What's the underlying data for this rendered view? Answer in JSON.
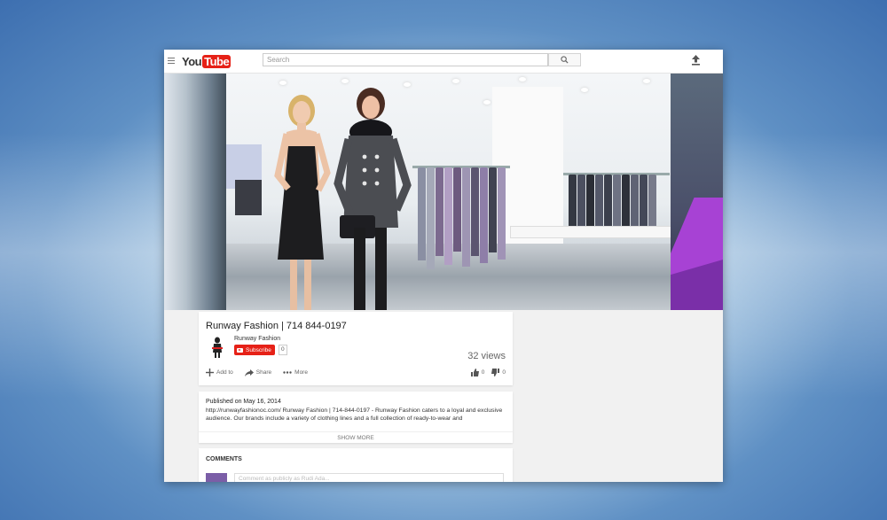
{
  "header": {
    "logo_you": "You",
    "logo_tube": "Tube",
    "search_placeholder": "Search"
  },
  "video": {
    "title": "Runway Fashion | 714 844-0197",
    "channel": "Runway Fashion",
    "subscribe_label": "Subscribe",
    "subscriber_count": "0",
    "views": "32 views"
  },
  "actions": {
    "add_to": "Add to",
    "share": "Share",
    "more": "More",
    "likes": "0",
    "dislikes": "0"
  },
  "description": {
    "published": "Published on May 16, 2014",
    "text": "http://runwayfashionoc.com/ Runway Fashion | 714-844-0197 - Runway Fashion caters to a loyal and exclusive audience. Our brands include a variety of clothing lines and a full collection of ready-to-wear and",
    "show_more": "SHOW MORE"
  },
  "comments": {
    "title": "COMMENTS",
    "input_placeholder": "Comment as publicly as Rudi Ada..."
  },
  "colors": {
    "brand_red": "#e62117",
    "accent_purple": "#a742d4"
  }
}
